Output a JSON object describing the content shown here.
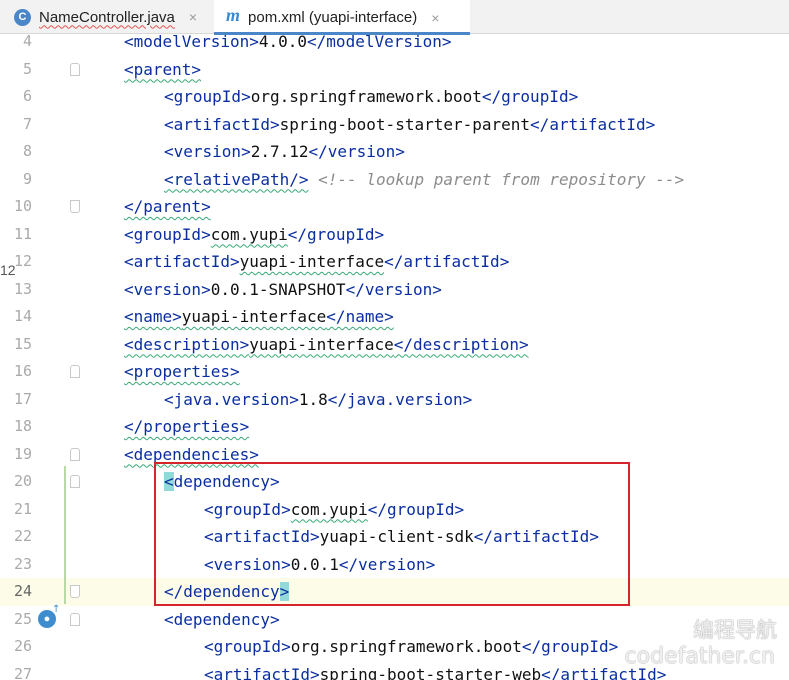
{
  "tabs": [
    {
      "icon": "C",
      "label": "NameController.java",
      "close": "×"
    },
    {
      "icon": "m",
      "label": "pom.xml (yuapi-interface)",
      "close": "×"
    }
  ],
  "lines": [
    {
      "n": "4",
      "indent": 1,
      "parts": [
        [
          "tag",
          "<modelVersion>"
        ],
        [
          "txt",
          "4.0.0"
        ],
        [
          "tag",
          "</modelVersion>"
        ]
      ]
    },
    {
      "n": "5",
      "indent": 1,
      "parts": [
        [
          "tag",
          "<parent>"
        ]
      ]
    },
    {
      "n": "6",
      "indent": 2,
      "parts": [
        [
          "tag",
          "<groupId>"
        ],
        [
          "txt",
          "org.springframework.boot"
        ],
        [
          "tag",
          "</groupId>"
        ]
      ]
    },
    {
      "n": "7",
      "indent": 2,
      "parts": [
        [
          "tag",
          "<artifactId>"
        ],
        [
          "txt",
          "spring-boot-starter-parent"
        ],
        [
          "tag",
          "</artifactId>"
        ]
      ]
    },
    {
      "n": "8",
      "indent": 2,
      "parts": [
        [
          "tag",
          "<version>"
        ],
        [
          "txt",
          "2.7.12"
        ],
        [
          "tag",
          "</version>"
        ]
      ]
    },
    {
      "n": "9",
      "indent": 2,
      "parts": [
        [
          "tag",
          "<relativePath/>"
        ],
        [
          "txt",
          " "
        ],
        [
          "comment",
          "<!-- lookup parent from repository -->"
        ]
      ]
    },
    {
      "n": "10",
      "indent": 1,
      "parts": [
        [
          "tag",
          "</parent>"
        ]
      ]
    },
    {
      "n": "11",
      "indent": 1,
      "parts": [
        [
          "tag",
          "<groupId>"
        ],
        [
          "txt",
          "com.yupi"
        ],
        [
          "tag",
          "</groupId>"
        ]
      ]
    },
    {
      "n": "12",
      "indent": 1,
      "parts": [
        [
          "tag",
          "<artifactId>"
        ],
        [
          "txt",
          "yuapi-interface"
        ],
        [
          "tag",
          "</artifactId>"
        ]
      ]
    },
    {
      "n": "13",
      "indent": 1,
      "parts": [
        [
          "tag",
          "<version>"
        ],
        [
          "txt",
          "0.0.1-SNAPSHOT"
        ],
        [
          "tag",
          "</version>"
        ]
      ]
    },
    {
      "n": "14",
      "indent": 1,
      "parts": [
        [
          "tag",
          "<name>"
        ],
        [
          "txt",
          "yuapi-interface"
        ],
        [
          "tag",
          "</name>"
        ]
      ]
    },
    {
      "n": "15",
      "indent": 1,
      "parts": [
        [
          "tag",
          "<description>"
        ],
        [
          "txt",
          "yuapi-interface"
        ],
        [
          "tag",
          "</description>"
        ]
      ]
    },
    {
      "n": "16",
      "indent": 1,
      "parts": [
        [
          "tag",
          "<properties>"
        ]
      ]
    },
    {
      "n": "17",
      "indent": 2,
      "parts": [
        [
          "tag",
          "<java.version>"
        ],
        [
          "txt",
          "1.8"
        ],
        [
          "tag",
          "</java.version>"
        ]
      ]
    },
    {
      "n": "18",
      "indent": 1,
      "parts": [
        [
          "tag",
          "</properties>"
        ]
      ]
    },
    {
      "n": "19",
      "indent": 1,
      "parts": [
        [
          "tag",
          "<dependencies>"
        ]
      ]
    },
    {
      "n": "20",
      "indent": 2,
      "parts": [
        [
          "tag",
          "<dependency>"
        ]
      ]
    },
    {
      "n": "21",
      "indent": 3,
      "parts": [
        [
          "tag",
          "<groupId>"
        ],
        [
          "txt",
          "com.yupi"
        ],
        [
          "tag",
          "</groupId>"
        ]
      ]
    },
    {
      "n": "22",
      "indent": 3,
      "parts": [
        [
          "tag",
          "<artifactId>"
        ],
        [
          "txt",
          "yuapi-client-sdk"
        ],
        [
          "tag",
          "</artifactId>"
        ]
      ]
    },
    {
      "n": "23",
      "indent": 3,
      "parts": [
        [
          "tag",
          "<version>"
        ],
        [
          "txt",
          "0.0.1"
        ],
        [
          "tag",
          "</version>"
        ]
      ]
    },
    {
      "n": "24",
      "indent": 2,
      "parts": [
        [
          "tag",
          "</dependency"
        ],
        [
          "tag",
          ">"
        ]
      ]
    },
    {
      "n": "25",
      "indent": 2,
      "parts": [
        [
          "tag",
          "<dependency>"
        ]
      ]
    },
    {
      "n": "26",
      "indent": 3,
      "parts": [
        [
          "tag",
          "<groupId>"
        ],
        [
          "txt",
          "org.springframework.boot"
        ],
        [
          "tag",
          "</groupId>"
        ]
      ]
    },
    {
      "n": "27",
      "indent": 3,
      "parts": [
        [
          "tag",
          "<artifactId>"
        ],
        [
          "txt",
          "spring-boot-starter-web"
        ],
        [
          "tag",
          "</artifactId>"
        ]
      ]
    }
  ],
  "gutter_side_number": "12",
  "watermark": {
    "line1": "编程导航",
    "line2": "codefather.cn"
  },
  "colors": {
    "tag": "#0a2ea0",
    "text": "#111111",
    "comment": "#8c8c8c",
    "highlight_box": "#d6242c",
    "tab_accent": "#4a86c8"
  }
}
